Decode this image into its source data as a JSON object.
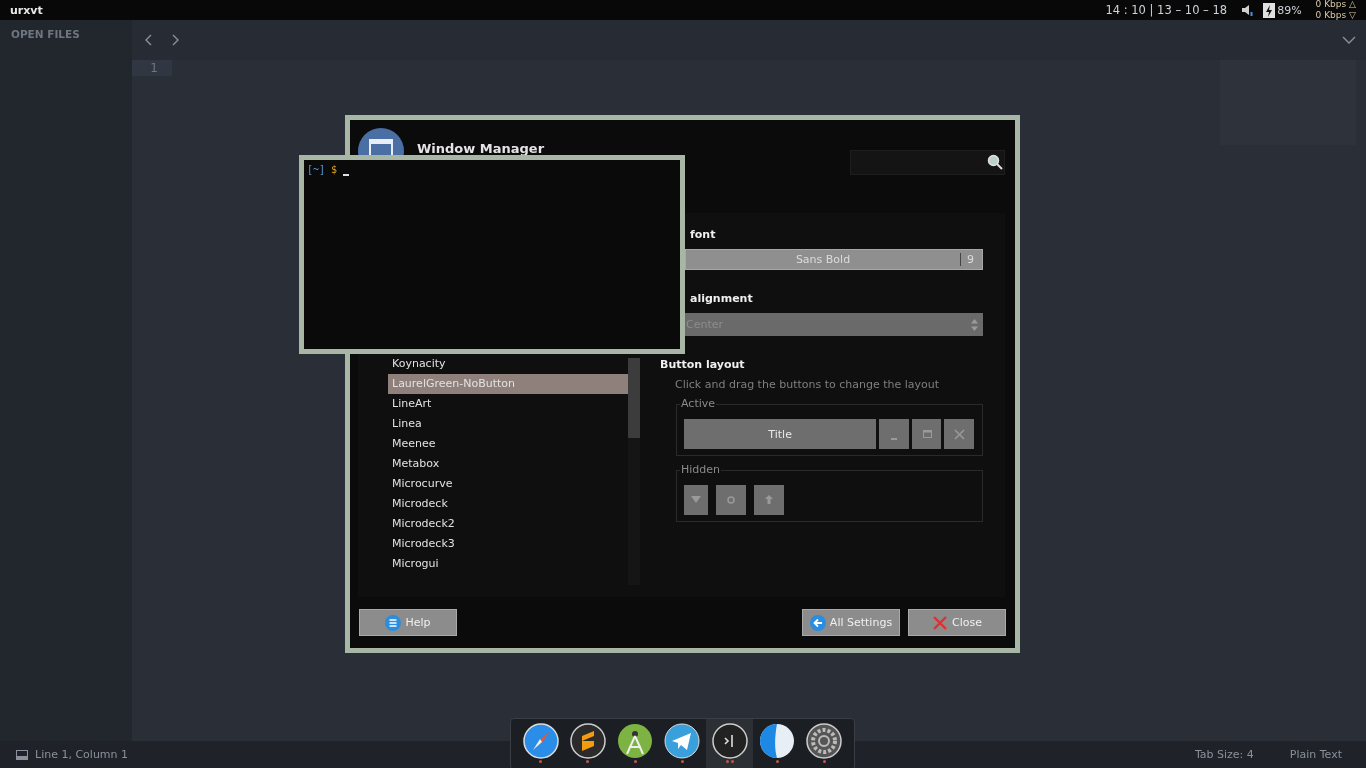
{
  "top_bar": {
    "title": "urxvt",
    "clock": "14 : 10 | 13 – 10 – 18",
    "battery": "89%",
    "upload": "0 Kbps △",
    "download": "0 Kbps ▽"
  },
  "editor": {
    "sidebar_title": "OPEN FILES",
    "line_numbers": [
      "1"
    ],
    "status_bar": {
      "position": "Line 1, Column 1",
      "tab_size": "Tab Size: 4",
      "syntax": "Plain Text"
    }
  },
  "dialog": {
    "title": "Window Manager",
    "themes": [
      {
        "name": "Koynacity",
        "selected": false
      },
      {
        "name": "LaurelGreen-NoButton",
        "selected": true
      },
      {
        "name": "LineArt",
        "selected": false
      },
      {
        "name": "Linea",
        "selected": false
      },
      {
        "name": "Meenee",
        "selected": false
      },
      {
        "name": "Metabox",
        "selected": false
      },
      {
        "name": "Microcurve",
        "selected": false
      },
      {
        "name": "Microdeck",
        "selected": false
      },
      {
        "name": "Microdeck2",
        "selected": false
      },
      {
        "name": "Microdeck3",
        "selected": false
      },
      {
        "name": "Microgui",
        "selected": false
      }
    ],
    "font_label": "font",
    "font": {
      "name": "Sans Bold",
      "size": "9"
    },
    "alignment_label": "alignment",
    "alignment": {
      "value": "Center",
      "disabled": true
    },
    "button_layout": {
      "heading": "Button layout",
      "hint": "Click and drag the buttons to change the layout",
      "active": {
        "label": "Active",
        "buttons": [
          {
            "kind": "title",
            "label": "Title"
          },
          {
            "kind": "minimize"
          },
          {
            "kind": "maximize"
          },
          {
            "kind": "close"
          }
        ]
      },
      "hidden": {
        "label": "Hidden",
        "buttons": [
          {
            "kind": "shade"
          },
          {
            "kind": "stick"
          },
          {
            "kind": "above"
          }
        ]
      }
    },
    "buttons": [
      {
        "kind": "help",
        "label": "Help"
      },
      {
        "kind": "back",
        "label": "All Settings"
      },
      {
        "kind": "close",
        "label": "Close"
      }
    ]
  },
  "terminal": {
    "cwd": "[~]",
    "prompt": "$"
  },
  "dock": [
    {
      "kind": "compass",
      "selected": false
    },
    {
      "kind": "editor",
      "selected": false
    },
    {
      "kind": "android",
      "selected": false
    },
    {
      "kind": "plane",
      "selected": false
    },
    {
      "kind": "terminal",
      "selected": true
    },
    {
      "kind": "split",
      "selected": false
    },
    {
      "kind": "gear",
      "selected": false
    }
  ]
}
